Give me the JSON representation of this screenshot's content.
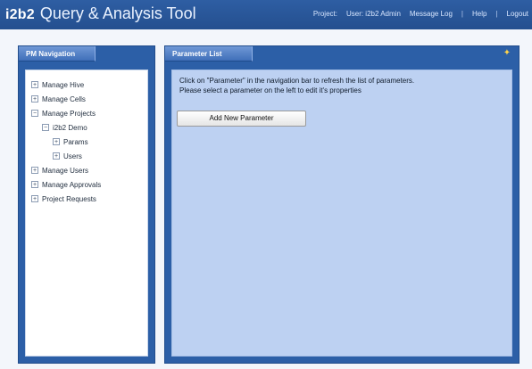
{
  "app": {
    "logo": "i2b2",
    "title": "Query & Analysis Tool"
  },
  "header": {
    "project_label": "Project:",
    "user_label": "User: i2b2 Admin",
    "links": [
      "Message Log",
      "Help",
      "Logout"
    ]
  },
  "left_panel": {
    "tab_label": "PM Navigation",
    "tree": [
      {
        "label": "Manage Hive",
        "expander": "+"
      },
      {
        "label": "Manage Cells",
        "expander": "+"
      },
      {
        "label": "Manage Projects",
        "expander": "−"
      },
      {
        "label": "i2b2 Demo",
        "expander": "−"
      },
      {
        "label": "Params",
        "expander": "+"
      },
      {
        "label": "Users",
        "expander": "+"
      },
      {
        "label": "Manage Users",
        "expander": "+"
      },
      {
        "label": "Manage Approvals",
        "expander": "+"
      },
      {
        "label": "Project Requests",
        "expander": "+"
      }
    ]
  },
  "right_panel": {
    "tab_label": "Parameter List",
    "message_line1": "Click on \"Parameter\" in the navigation bar to refresh the list of parameters.",
    "message_line2": "Please select a parameter on the left to edit it's properties",
    "add_button_label": "Add New Parameter",
    "icon": "help-icon"
  },
  "colors": {
    "header_blue": "#2e5ea3",
    "panel_blue": "#2c5fa7",
    "content_bg": "#bdd1f2"
  }
}
